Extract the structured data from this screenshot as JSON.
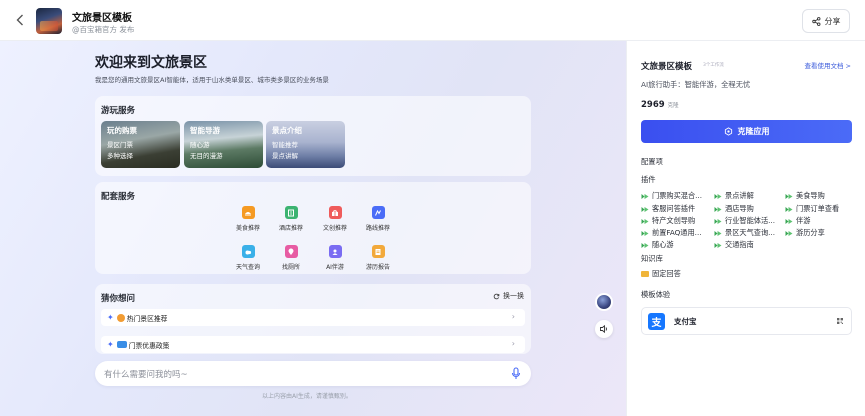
{
  "header": {
    "back_icon": "chevron-left-icon",
    "title": "文旅景区模板",
    "subtitle": "@百宝箱官方 发布",
    "share_label": "分享",
    "share_icon": "share-icon"
  },
  "main": {
    "welcome_title": "欢迎来到文旅景区",
    "welcome_desc": "我是您的通用文旅景区AI智能体，适用于山水类单景区、城市类多景区的业务场景",
    "play_services": {
      "title": "游玩服务",
      "tiles": [
        {
          "title": "玩的购票",
          "line1": "景区门票",
          "line2": "多种选择"
        },
        {
          "title": "智能导游",
          "line1": "随心游",
          "line2": "无目的漫游"
        },
        {
          "title": "景点介绍",
          "line1": "智能推荐",
          "line2": "景点讲解"
        }
      ]
    },
    "support_services": {
      "title": "配套服务",
      "items": [
        {
          "label": "美食推荐",
          "icon": "food-icon",
          "color": "#f59a23"
        },
        {
          "label": "酒店推荐",
          "icon": "hotel-icon",
          "color": "#3cb371"
        },
        {
          "label": "文创推荐",
          "icon": "gift-icon",
          "color": "#ef5b5b"
        },
        {
          "label": "路线推荐",
          "icon": "route-icon",
          "color": "#4a6cf7"
        },
        {
          "label": "天气查询",
          "icon": "weather-icon",
          "color": "#3ab0e8"
        },
        {
          "label": "找厕所",
          "icon": "location-icon",
          "color": "#e75ca3"
        },
        {
          "label": "AI伴游",
          "icon": "ai-companion-icon",
          "color": "#7a6cf2"
        },
        {
          "label": "游历报告",
          "icon": "report-icon",
          "color": "#f2a93b"
        }
      ]
    },
    "guess": {
      "title": "猜你想问",
      "refresh_label": "换一换",
      "items": [
        {
          "label": "热门景区推荐"
        },
        {
          "label": "门票优惠政策"
        }
      ]
    },
    "input_placeholder": "有什么需要问我的吗~",
    "disclaimer": "以上内容由AI生成，请谨慎甄别。"
  },
  "panel": {
    "title": "文旅景区模板",
    "badge": "3个工作流",
    "doc_link": "查看使用文档 >",
    "description": "AI旅行助手：智能伴游，全程无忧",
    "count": "2969",
    "count_label": "克隆",
    "clone_button": "克隆应用",
    "config_label": "配置项",
    "plugins_label": "插件",
    "plugins": [
      [
        "门票购买混合...",
        "景点讲解",
        "美食导购"
      ],
      [
        "客服问答插件",
        "酒店导购",
        "门票订单查看"
      ],
      [
        "特产文创导购",
        "行业智能体活...",
        "伴游"
      ],
      [
        "前置FAQ通用...",
        "景区天气查询...",
        "游历分享"
      ],
      [
        "随心游",
        "交通指南",
        ""
      ]
    ],
    "kb_label": "知识库",
    "kb_item": "固定回答",
    "experience_label": "模板体验",
    "alipay_name": "支付宝",
    "alipay_logo_char": "支",
    "alipay_action_icon": "qr-code-icon"
  }
}
